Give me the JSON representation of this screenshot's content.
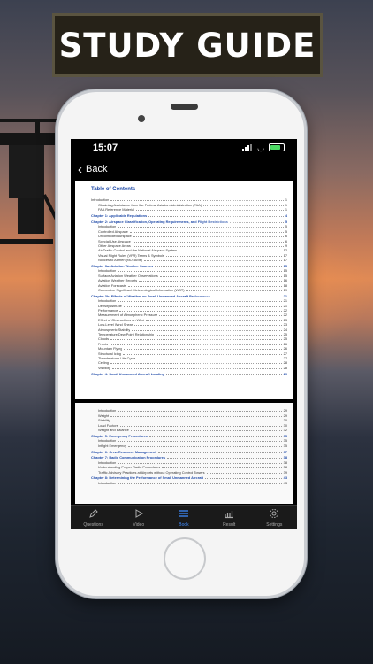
{
  "banner": {
    "title": "STUDY GUIDE"
  },
  "status_bar": {
    "time": "15:07"
  },
  "nav": {
    "back_label": "Back"
  },
  "document": {
    "toc_title": "Table of Contents",
    "page1_rows": [
      {
        "text": "Introduction",
        "page": "1",
        "kind": "chapter-plain"
      },
      {
        "text": "Obtaining Assistance from the Federal Aviation Administration (FAA)",
        "page": "1",
        "kind": "indent"
      },
      {
        "text": "FAA Reference Material",
        "page": "1",
        "kind": "indent"
      },
      {
        "text": "Chapter 1: Applicable Regulations",
        "page": "4",
        "kind": "chapter"
      },
      {
        "text": "Chapter 2: Airspace Classification, Operating Requirements, and Flight Restrictions",
        "page": "5",
        "kind": "chapter"
      },
      {
        "text": "Introduction",
        "page": "5",
        "kind": "indent"
      },
      {
        "text": "Controlled Airspace",
        "page": "5",
        "kind": "indent"
      },
      {
        "text": "Uncontrolled Airspace",
        "page": "6",
        "kind": "indent"
      },
      {
        "text": "Special Use Airspace",
        "page": "6",
        "kind": "indent"
      },
      {
        "text": "Other Airspace Areas",
        "page": "9",
        "kind": "indent"
      },
      {
        "text": "Air Traffic Control and the National Airspace System",
        "page": "12",
        "kind": "indent"
      },
      {
        "text": "Visual Flight Rules (VFR) Terms & Symbols",
        "page": "17",
        "kind": "indent"
      },
      {
        "text": "Notices to Airmen (NOTAMs)",
        "page": "17",
        "kind": "indent"
      },
      {
        "text": "Chapter 3a: Aviation Weather Sources",
        "page": "15",
        "kind": "chapter"
      },
      {
        "text": "Introduction",
        "page": "15",
        "kind": "indent"
      },
      {
        "text": "Surface Aviation Weather Observations",
        "page": "15",
        "kind": "indent"
      },
      {
        "text": "Aviation Weather Reports",
        "page": "16",
        "kind": "indent"
      },
      {
        "text": "Aviation Forecasts",
        "page": "18",
        "kind": "indent"
      },
      {
        "text": "Convective Significant Meteorological Information (WST)",
        "page": "19",
        "kind": "indent"
      },
      {
        "text": "Chapter 3b: Effects of Weather on Small Unmanned Aircraft Performance",
        "page": "21",
        "kind": "chapter"
      },
      {
        "text": "Introduction",
        "page": "21",
        "kind": "indent"
      },
      {
        "text": "Density Altitude",
        "page": "21",
        "kind": "indent"
      },
      {
        "text": "Performance",
        "page": "22",
        "kind": "indent"
      },
      {
        "text": "Measurement of Atmospheric Pressure",
        "page": "22",
        "kind": "indent"
      },
      {
        "text": "Effect of Obstructions on Wind",
        "page": "23",
        "kind": "indent"
      },
      {
        "text": "Low-Level Wind Shear",
        "page": "23",
        "kind": "indent"
      },
      {
        "text": "Atmospheric Stability",
        "page": "24",
        "kind": "indent"
      },
      {
        "text": "Temperature/Dew Point Relationship",
        "page": "25",
        "kind": "indent"
      },
      {
        "text": "Clouds",
        "page": "25",
        "kind": "indent"
      },
      {
        "text": "Fronts",
        "page": "26",
        "kind": "indent"
      },
      {
        "text": "Mountain Flying",
        "page": "26",
        "kind": "indent"
      },
      {
        "text": "Structural Icing",
        "page": "27",
        "kind": "indent"
      },
      {
        "text": "Thunderstorm Life Cycle",
        "page": "27",
        "kind": "indent"
      },
      {
        "text": "Ceiling",
        "page": "28",
        "kind": "indent"
      },
      {
        "text": "Visibility",
        "page": "28",
        "kind": "indent"
      },
      {
        "text": "Chapter 4: Small Unmanned Aircraft Loading",
        "page": "29",
        "kind": "chapter"
      }
    ],
    "page2_rows": [
      {
        "text": "Introduction",
        "page": "29",
        "kind": "indent"
      },
      {
        "text": "Weight",
        "page": "29",
        "kind": "indent"
      },
      {
        "text": "Stability",
        "page": "30",
        "kind": "indent"
      },
      {
        "text": "Load Factors",
        "page": "30",
        "kind": "indent"
      },
      {
        "text": "Weight and Balance",
        "page": "32",
        "kind": "indent"
      },
      {
        "text": "Chapter 5: Emergency Procedures",
        "page": "35",
        "kind": "chapter"
      },
      {
        "text": "Introduction",
        "page": "35",
        "kind": "indent"
      },
      {
        "text": "Inflight Emergency",
        "page": "35",
        "kind": "indent"
      },
      {
        "text": "Chapter 6: Crew Resource Management",
        "page": "37",
        "kind": "chapter"
      },
      {
        "text": "Chapter 7: Radio Communication Procedures",
        "page": "38",
        "kind": "chapter"
      },
      {
        "text": "Introduction",
        "page": "38",
        "kind": "indent"
      },
      {
        "text": "Understanding Proper Radio Procedures",
        "page": "38",
        "kind": "indent"
      },
      {
        "text": "Traffic Advisory Practices at Airports without Operating Control Towers",
        "page": "39",
        "kind": "indent"
      },
      {
        "text": "Chapter 8: Determining the Performance of Small Unmanned Aircraft",
        "page": "43",
        "kind": "chapter"
      },
      {
        "text": "Introduction",
        "page": "43",
        "kind": "indent"
      }
    ]
  },
  "tabbar": {
    "tabs": [
      {
        "label": "Questions",
        "icon": "pencil-icon"
      },
      {
        "label": "Video",
        "icon": "play-icon"
      },
      {
        "label": "Book",
        "icon": "book-icon"
      },
      {
        "label": "Result",
        "icon": "chart-icon"
      },
      {
        "label": "Settings",
        "icon": "gear-icon"
      }
    ],
    "active_index": 2,
    "active_color": "#3f8cff"
  }
}
